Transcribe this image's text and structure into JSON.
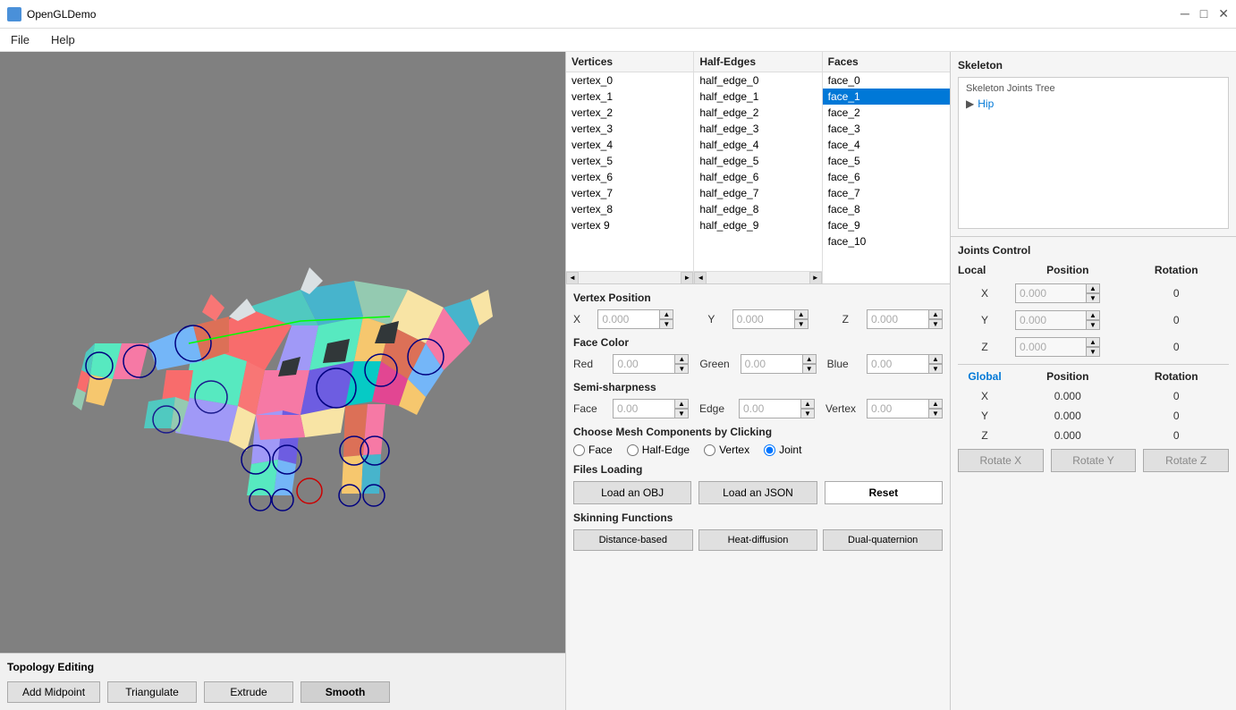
{
  "app": {
    "title": "OpenGLDemo",
    "icon": "opengl-icon"
  },
  "titlebar": {
    "controls": {
      "minimize": "─",
      "maximize": "□",
      "close": "✕"
    }
  },
  "menubar": {
    "items": [
      {
        "label": "File",
        "id": "file"
      },
      {
        "label": "Help",
        "id": "help"
      }
    ]
  },
  "vertices": {
    "header": "Vertices",
    "items": [
      "vertex_0",
      "vertex_1",
      "vertex_2",
      "vertex_3",
      "vertex_4",
      "vertex_5",
      "vertex_6",
      "vertex_7",
      "vertex_8",
      "vertex 9"
    ]
  },
  "half_edges": {
    "header": "Half-Edges",
    "items": [
      "half_edge_0",
      "half_edge_1",
      "half_edge_2",
      "half_edge_3",
      "half_edge_4",
      "half_edge_5",
      "half_edge_6",
      "half_edge_7",
      "half_edge_8",
      "half_edge_9"
    ]
  },
  "faces": {
    "header": "Faces",
    "items": [
      "face_0",
      "face_1",
      "face_2",
      "face_3",
      "face_4",
      "face_5",
      "face_6",
      "face_7",
      "face_8",
      "face_9",
      "face_10"
    ],
    "selected_index": 1
  },
  "vertex_position": {
    "label": "Vertex Position",
    "x_label": "X",
    "y_label": "Y",
    "z_label": "Z",
    "x_value": "0.000",
    "y_value": "0.000",
    "z_value": "0.000"
  },
  "face_color": {
    "label": "Face Color",
    "red_label": "Red",
    "green_label": "Green",
    "blue_label": "Blue",
    "red_value": "0.00",
    "green_value": "0.00",
    "blue_value": "0.00"
  },
  "semi_sharpness": {
    "label": "Semi-sharpness",
    "face_label": "Face",
    "edge_label": "Edge",
    "vertex_label": "Vertex",
    "face_value": "0.00",
    "edge_value": "0.00",
    "vertex_value": "0.00"
  },
  "mesh_components": {
    "label": "Choose Mesh Components by Clicking",
    "options": [
      {
        "id": "face",
        "label": "Face",
        "checked": false
      },
      {
        "id": "half-edge",
        "label": "Half-Edge",
        "checked": false
      },
      {
        "id": "vertex",
        "label": "Vertex",
        "checked": false
      },
      {
        "id": "joint",
        "label": "Joint",
        "checked": true
      }
    ]
  },
  "files_loading": {
    "label": "Files Loading",
    "load_obj": "Load an OBJ",
    "load_json": "Load an JSON",
    "reset": "Reset"
  },
  "skinning": {
    "label": "Skinning Functions",
    "distance": "Distance-based",
    "heat": "Heat-diffusion",
    "dual": "Dual-quaternion"
  },
  "topology": {
    "label": "Topology Editing",
    "buttons": [
      {
        "id": "add-midpoint",
        "label": "Add Midpoint"
      },
      {
        "id": "triangulate",
        "label": "Triangulate"
      },
      {
        "id": "extrude",
        "label": "Extrude"
      },
      {
        "id": "smooth",
        "label": "Smooth"
      }
    ]
  },
  "skeleton": {
    "header": "Skeleton",
    "tree_header": "Skeleton Joints Tree",
    "items": [
      {
        "label": "Hip",
        "has_arrow": true,
        "is_link": true
      }
    ]
  },
  "joints_control": {
    "header": "Joints Control",
    "local_label": "Local",
    "position_label": "Position",
    "rotation_label": "Rotation",
    "local_rows": [
      {
        "axis": "X",
        "position": "0.000",
        "rotation": "0"
      },
      {
        "axis": "Y",
        "position": "0.000",
        "rotation": "0"
      },
      {
        "axis": "Z",
        "position": "0.000",
        "rotation": "0"
      }
    ],
    "global_label": "Global",
    "global_position_label": "Position",
    "global_rotation_label": "Rotation",
    "global_rows": [
      {
        "axis": "X",
        "position": "0.000",
        "rotation": "0"
      },
      {
        "axis": "Y",
        "position": "0.000",
        "rotation": "0"
      },
      {
        "axis": "Z",
        "position": "0.000",
        "rotation": "0"
      }
    ],
    "rotate_x": "Rotate X",
    "rotate_y": "Rotate Y",
    "rotate_z": "Rotate Z"
  }
}
